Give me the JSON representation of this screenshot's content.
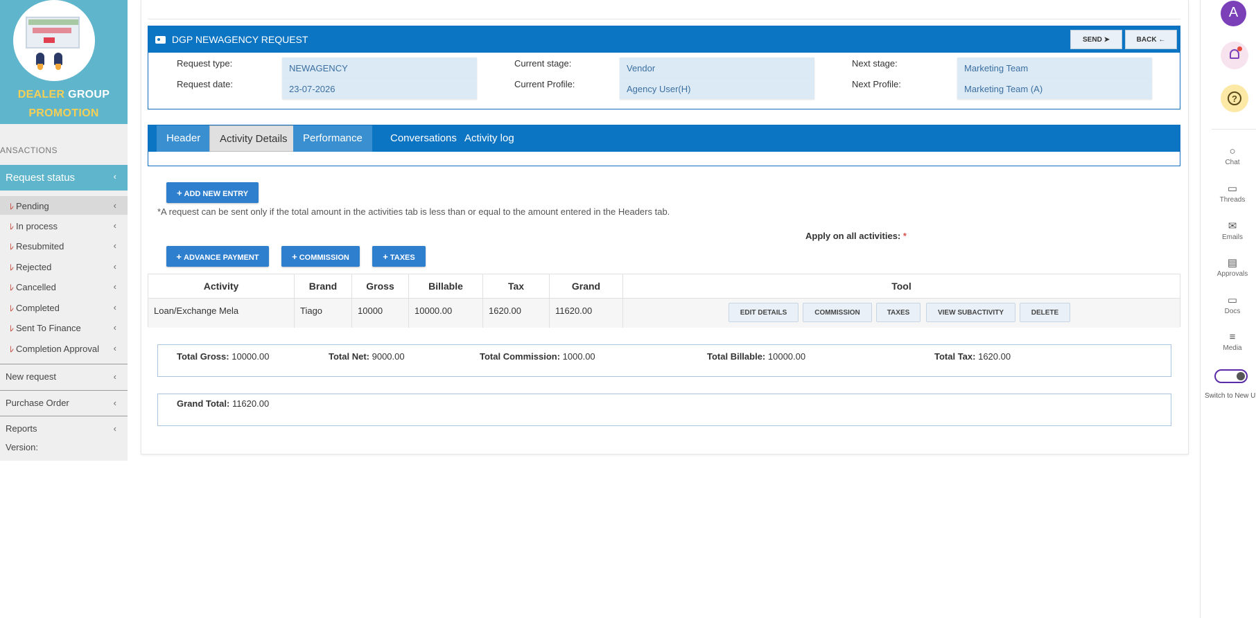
{
  "sidebar": {
    "brand_line1_a": "DEALER",
    "brand_line1_b": "GROUP",
    "brand_line2": "PROMOTION",
    "section_label": "ANSACTIONS",
    "status_head": "Request status",
    "status_items": [
      {
        "label": "Pending"
      },
      {
        "label": "In process"
      },
      {
        "label": "Resubmited"
      },
      {
        "label": "Rejected"
      },
      {
        "label": "Cancelled"
      },
      {
        "label": "Completed"
      },
      {
        "label": "Sent To Finance"
      },
      {
        "label": "Completion Approval"
      }
    ],
    "main_items": [
      {
        "label": "New request"
      },
      {
        "label": "Purchase Order"
      },
      {
        "label": "Reports"
      }
    ],
    "version_label": "Version:",
    "chevron": "‹",
    "flag_glyph": "ﾚ"
  },
  "request": {
    "title": "DGP NEWAGENCY REQUEST",
    "send_label": "SEND",
    "back_label": "BACK",
    "fields": {
      "request_type_label": "Request type:",
      "request_type_value": "NEWAGENCY",
      "request_date_label": "Request date:",
      "request_date_value": "23-07-2026",
      "current_stage_label": "Current stage:",
      "current_stage_value": "Vendor",
      "current_profile_label": "Current Profile:",
      "current_profile_value": "Agency User(H)",
      "next_stage_label": "Next stage:",
      "next_stage_value": "Marketing Team",
      "next_profile_label": "Next Profile:",
      "next_profile_value": "Marketing Team (A)"
    }
  },
  "tabs": [
    {
      "label": "Header"
    },
    {
      "label": "Activity Details"
    },
    {
      "label": "Performance"
    },
    {
      "label": "Conversations"
    },
    {
      "label": "Activity log"
    }
  ],
  "activity": {
    "add_entry_label": "ADD NEW ENTRY",
    "note": "*A request can be sent only if the total amount in the activities tab is less than or equal to the amount entered in the Headers tab.",
    "apply_label": "Apply on all activities:",
    "apply_required": "*",
    "advance_payment_label": "ADVANCE PAYMENT",
    "commission_label": "COMMISSION",
    "taxes_label": "TAXES",
    "plus": "+"
  },
  "table": {
    "headers": [
      "Activity",
      "Brand",
      "Gross",
      "Billable",
      "Tax",
      "Grand",
      "Tool"
    ],
    "rows": [
      {
        "activity": "Loan/Exchange Mela",
        "brand": "Tiago",
        "gross": "10000",
        "billable": "10000.00",
        "tax": "1620.00",
        "grand": "11620.00"
      }
    ],
    "tools": [
      "EDIT DETAILS",
      "COMMISSION",
      "TAXES",
      "VIEW SUBACTIVITY",
      "DELETE"
    ]
  },
  "totals": {
    "gross_label": "Total Gross:",
    "gross_value": "10000.00",
    "net_label": "Total Net:",
    "net_value": "9000.00",
    "commission_label": "Total Commission:",
    "commission_value": "1000.00",
    "billable_label": "Total Billable:",
    "billable_value": "10000.00",
    "tax_label": "Total Tax:",
    "tax_value": "1620.00",
    "grand_label": "Grand Total:",
    "grand_value": "11620.00"
  },
  "rail": {
    "avatar_letter": "A",
    "help_glyph": "?",
    "items": [
      {
        "label": "Chat",
        "icon": "chat-icon",
        "glyph": "○"
      },
      {
        "label": "Threads",
        "icon": "threads-icon",
        "glyph": "▭"
      },
      {
        "label": "Emails",
        "icon": "mail-icon",
        "glyph": "✉"
      },
      {
        "label": "Approvals",
        "icon": "document-icon",
        "glyph": "▤"
      },
      {
        "label": "Docs",
        "icon": "folder-icon",
        "glyph": "▭"
      },
      {
        "label": "Media",
        "icon": "database-icon",
        "glyph": "≡"
      }
    ],
    "switch_label": "Switch to New U"
  },
  "colors": {
    "brand_teal": "#5fb5cb",
    "header_blue": "#0b75c4",
    "button_blue": "#2f7fcf",
    "field_bg": "#dceaf6",
    "avatar_purple": "#7b3fb8",
    "required_red": "#d9534f"
  }
}
